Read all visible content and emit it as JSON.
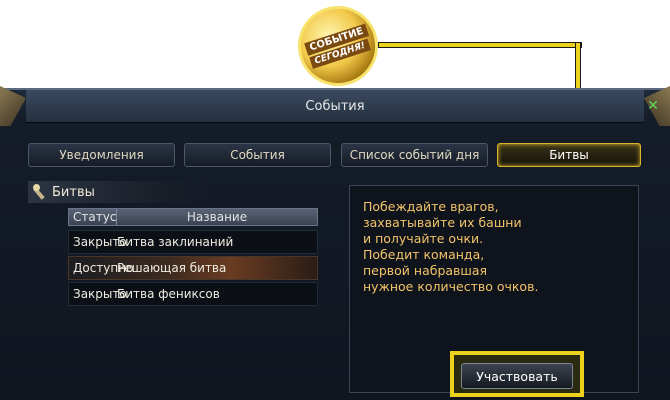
{
  "callout": {
    "badge_line1": "СОБЫТИЕ",
    "badge_line2": "СЕГОДНЯ!",
    "accent_color": "#ecd21c"
  },
  "window": {
    "title": "События",
    "close_icon": "close-x-icon"
  },
  "tabs": [
    {
      "label": "Уведомления",
      "active": false
    },
    {
      "label": "События",
      "active": false
    },
    {
      "label": "Список событий дня",
      "active": false
    },
    {
      "label": "Битвы",
      "active": true
    }
  ],
  "section": {
    "icon": "torch-icon",
    "label": "Битвы"
  },
  "table": {
    "columns": [
      "Статус",
      "Название"
    ],
    "rows": [
      {
        "status": "Закрыто",
        "name": "Битва заклинаний",
        "selected": false
      },
      {
        "status": "Доступно",
        "name": "Решающая битва",
        "selected": true
      },
      {
        "status": "Закрыто",
        "name": "Битва фениксов",
        "selected": false
      }
    ]
  },
  "description": {
    "text": "Побеждайте врагов,\nзахватывайте их башни\nи получайте очки.\nПобедит команда,\nпервой набравшая\nнужное количество очков."
  },
  "actions": {
    "join_label": "Участвовать"
  },
  "colors": {
    "desc_text": "#f2c36a",
    "active_tab_border": "#d9b52c",
    "selected_row": "#6a3c22"
  }
}
